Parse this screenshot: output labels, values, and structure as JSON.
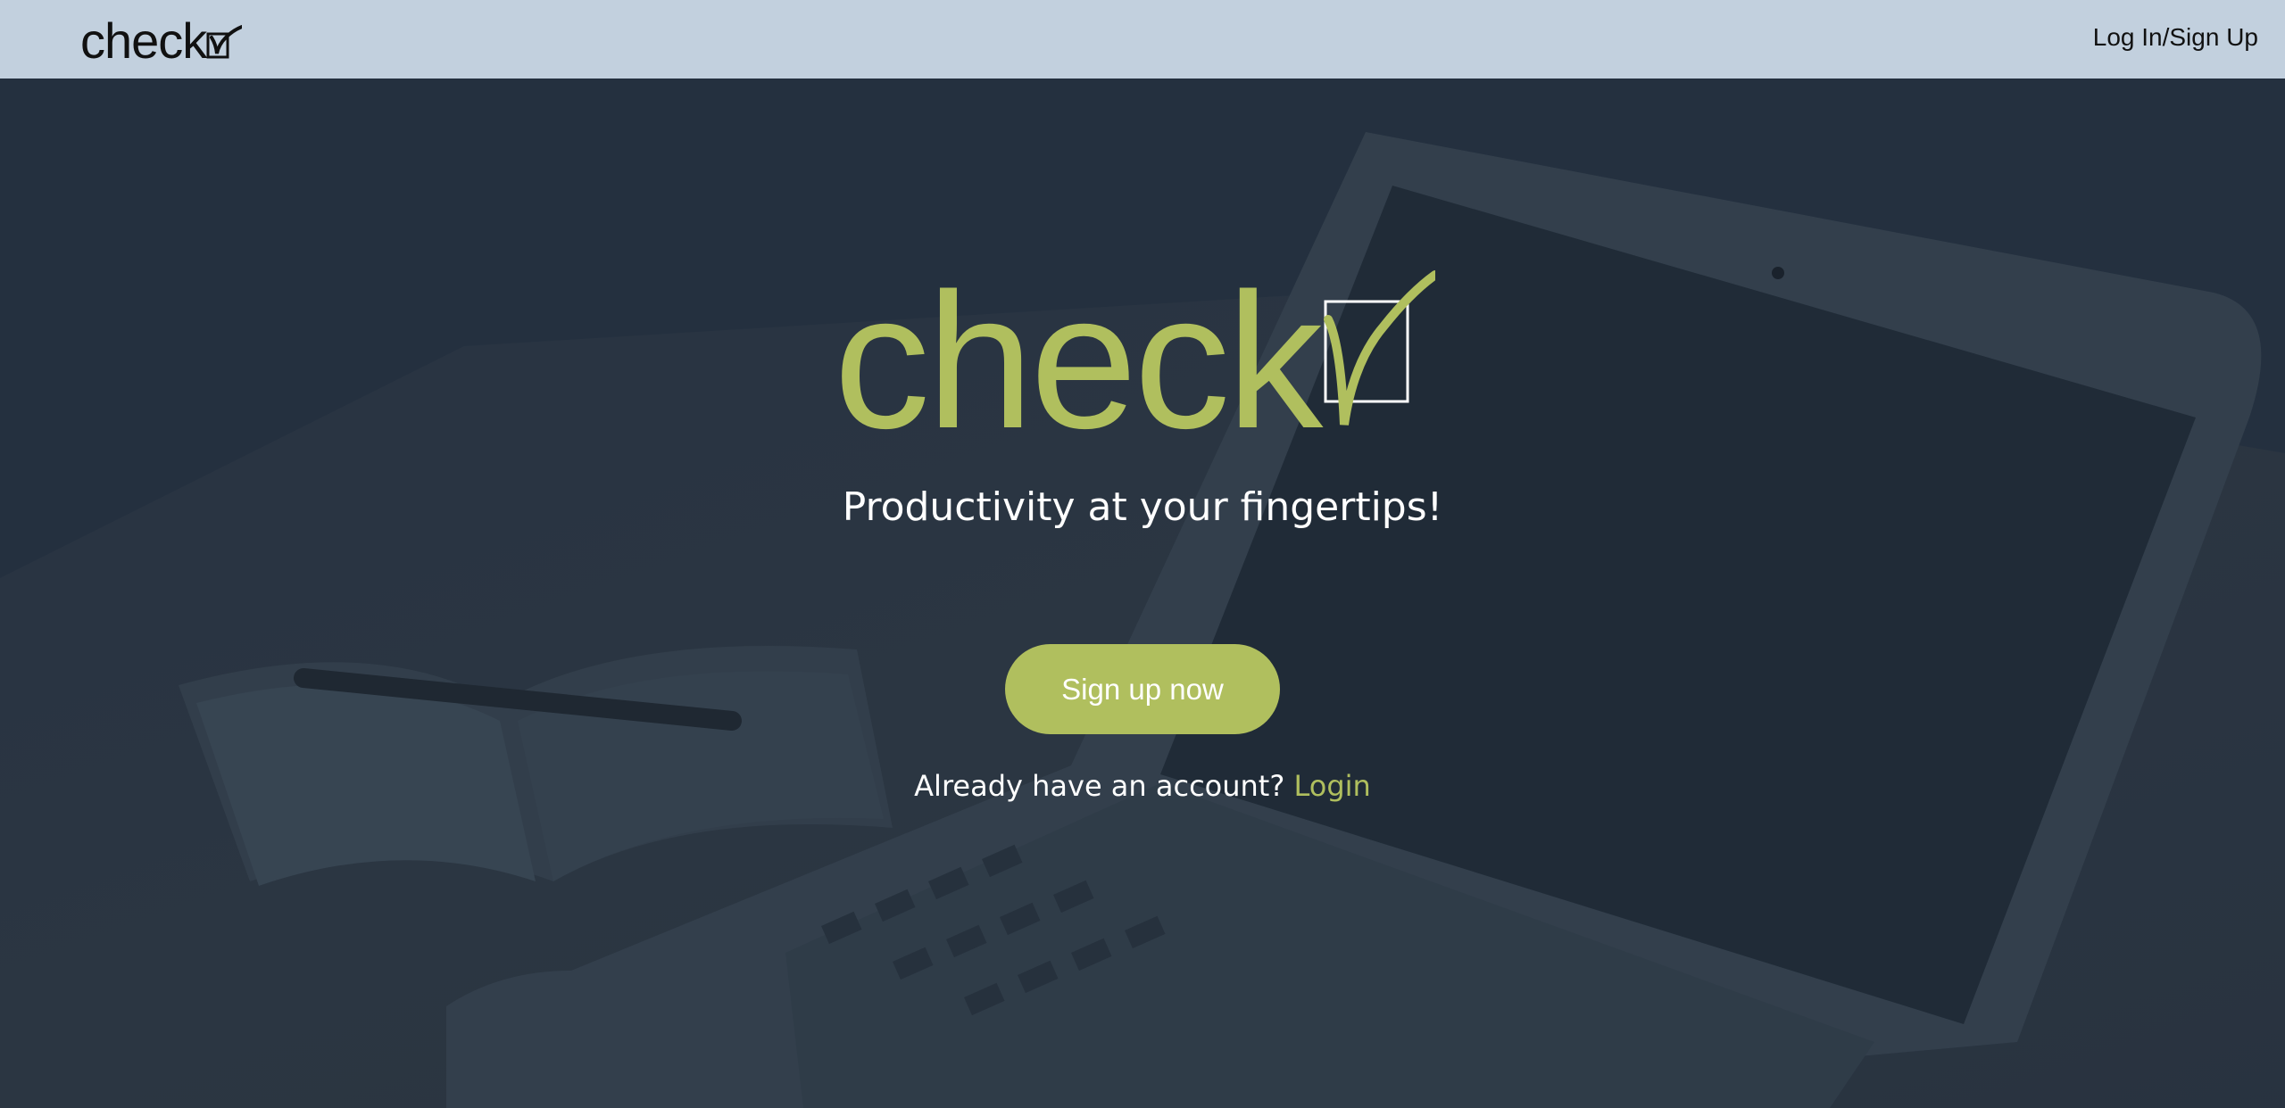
{
  "navbar": {
    "logo_text": "check",
    "auth_link": "Log In/Sign Up"
  },
  "hero": {
    "logo_text": "check",
    "tagline": "Productivity at your fingertips!",
    "signup_button": "Sign up now",
    "account_prompt": "Already have an account?",
    "login_link": "Login"
  },
  "colors": {
    "navbar_bg": "#c2d0de",
    "hero_overlay": "#253240",
    "accent": "#b0bf5e",
    "text_light": "#ffffff",
    "text_dark": "#111111"
  },
  "icons": {
    "logo_mark": "checkbox-check-icon",
    "background": "laptop-notebook-photo"
  }
}
